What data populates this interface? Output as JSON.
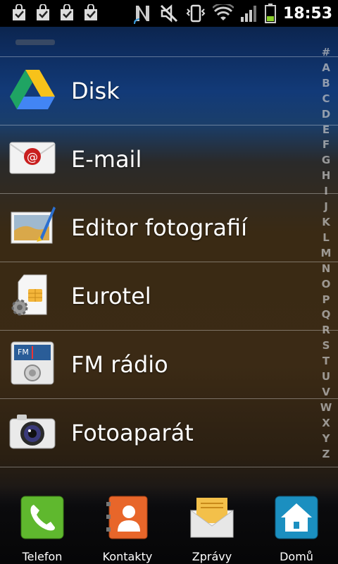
{
  "status_bar": {
    "time": "18:53",
    "icons": [
      "notification-bag-icon",
      "notification-bag-icon",
      "notification-bag-icon",
      "notification-bag-icon",
      "nfc-icon",
      "mute-icon",
      "vibrate-icon",
      "wifi-icon",
      "signal-icon",
      "battery-icon"
    ]
  },
  "apps": [
    {
      "label": "Disk",
      "icon": "google-drive-icon"
    },
    {
      "label": "E-mail",
      "icon": "email-icon"
    },
    {
      "label": "Editor fotografií",
      "icon": "photo-editor-icon"
    },
    {
      "label": "Eurotel",
      "icon": "sim-toolkit-icon"
    },
    {
      "label": "FM rádio",
      "icon": "fm-radio-icon"
    },
    {
      "label": "Fotoaparát",
      "icon": "camera-icon"
    }
  ],
  "index_letters": [
    "#",
    "A",
    "B",
    "C",
    "D",
    "E",
    "F",
    "G",
    "H",
    "I",
    "J",
    "K",
    "L",
    "M",
    "N",
    "O",
    "P",
    "Q",
    "R",
    "S",
    "T",
    "U",
    "V",
    "W",
    "X",
    "Y",
    "Z"
  ],
  "dock": [
    {
      "label": "Telefon",
      "icon": "phone-icon"
    },
    {
      "label": "Kontakty",
      "icon": "contacts-icon"
    },
    {
      "label": "Zprávy",
      "icon": "messages-icon"
    },
    {
      "label": "Domů",
      "icon": "home-icon"
    }
  ]
}
